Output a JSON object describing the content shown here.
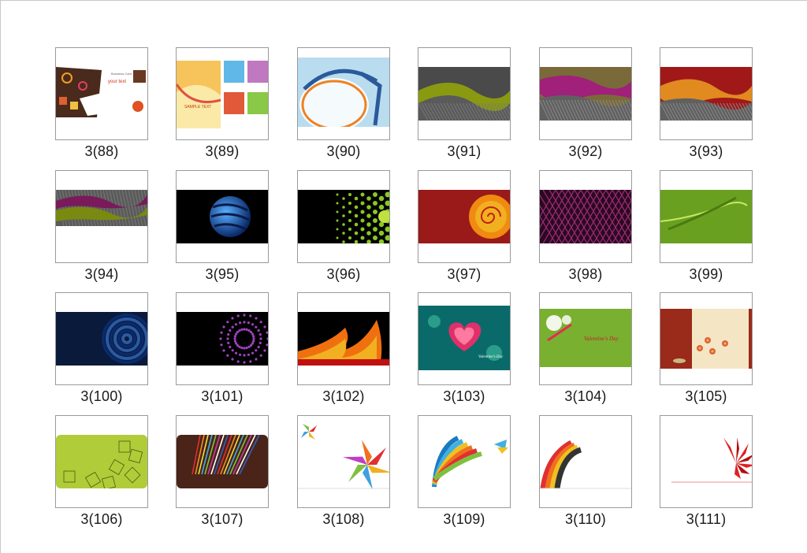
{
  "sheet": {
    "items": [
      {
        "label": "3(88)",
        "art": "card-sample-text"
      },
      {
        "label": "3(89)",
        "art": "colorful-brochure"
      },
      {
        "label": "3(90)",
        "art": "blue-swirl-film"
      },
      {
        "label": "3(91)",
        "art": "olive-wave"
      },
      {
        "label": "3(92)",
        "art": "magenta-wave"
      },
      {
        "label": "3(93)",
        "art": "red-orange-wave"
      },
      {
        "label": "3(94)",
        "art": "purple-olive-wave"
      },
      {
        "label": "3(95)",
        "art": "blue-sphere"
      },
      {
        "label": "3(96)",
        "art": "green-dots"
      },
      {
        "label": "3(97)",
        "art": "red-spiral"
      },
      {
        "label": "3(98)",
        "art": "magenta-mesh"
      },
      {
        "label": "3(99)",
        "art": "green-swirl"
      },
      {
        "label": "3(100)",
        "art": "blue-tunnel"
      },
      {
        "label": "3(101)",
        "art": "purple-dot-ring"
      },
      {
        "label": "3(102)",
        "art": "orange-flame"
      },
      {
        "label": "3(103)",
        "art": "valentine-heart"
      },
      {
        "label": "3(104)",
        "art": "valentine-green"
      },
      {
        "label": "3(105)",
        "art": "red-cream-floral"
      },
      {
        "label": "3(106)",
        "art": "lime-squares"
      },
      {
        "label": "3(107)",
        "art": "brown-stripes"
      },
      {
        "label": "3(108)",
        "art": "pinwheel"
      },
      {
        "label": "3(109)",
        "art": "ribbon-burst"
      },
      {
        "label": "3(110)",
        "art": "curled-ribbons"
      },
      {
        "label": "3(111)",
        "art": "red-bow"
      }
    ],
    "thumb_texts": {
      "card_title": "Business Card",
      "card_sub": "your text",
      "brochure_text": "SAMPLE TEXT",
      "valentine_text": "Valentine's Day"
    }
  }
}
